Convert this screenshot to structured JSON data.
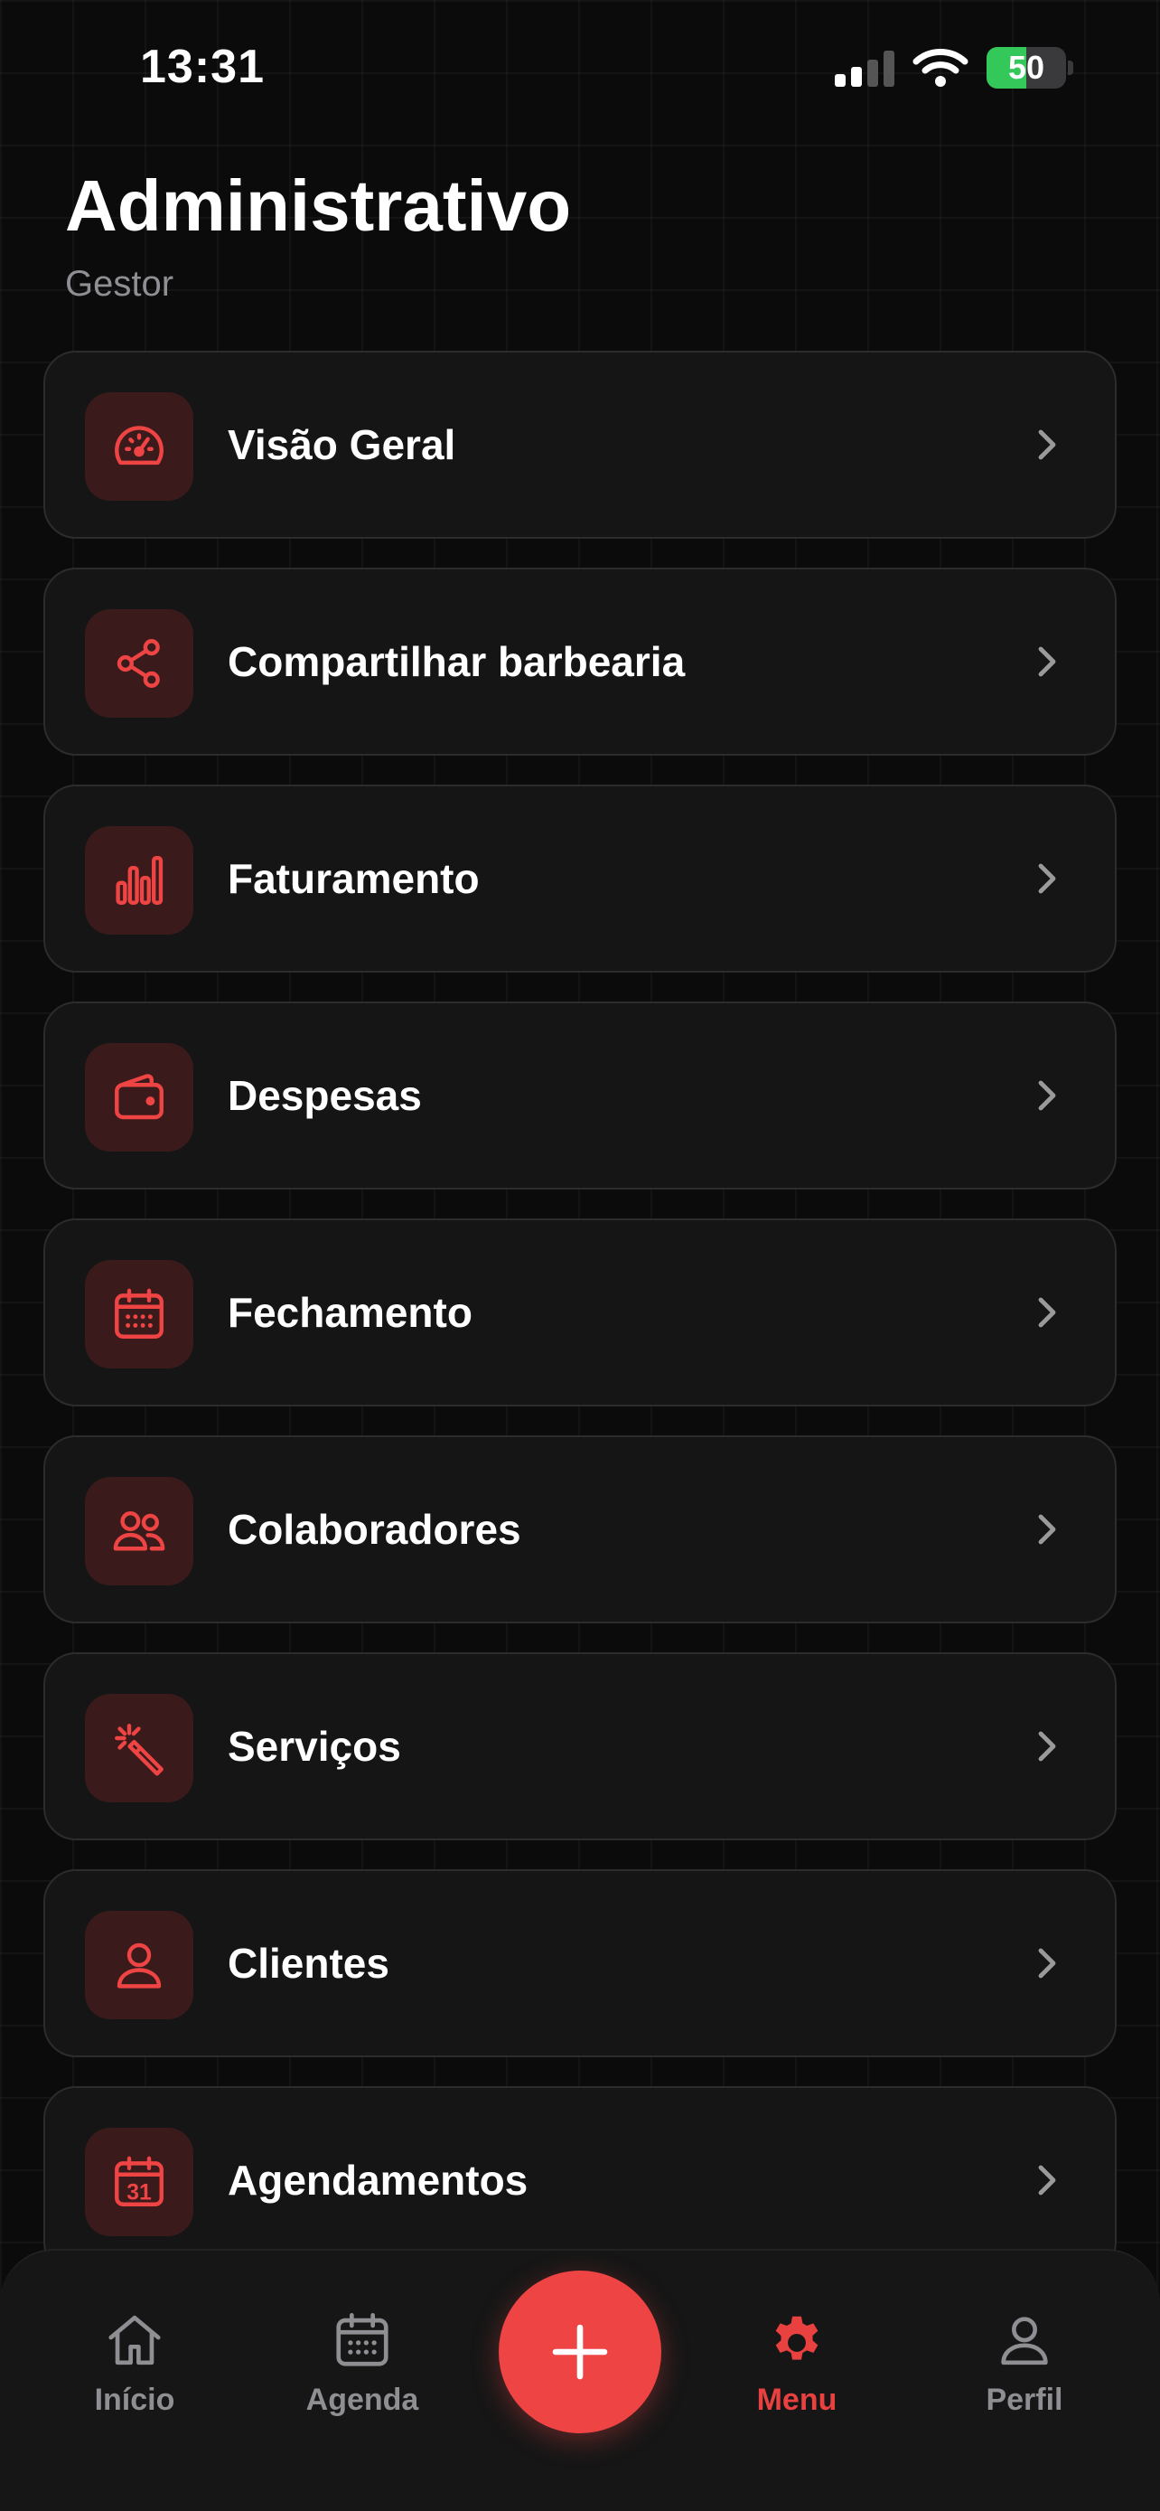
{
  "status_bar": {
    "time": "13:31",
    "battery": "50",
    "battery_level": 0.5
  },
  "header": {
    "title": "Administrativo",
    "subtitle": "Gestor"
  },
  "menu": {
    "items": [
      {
        "label": "Visão Geral",
        "icon": "speedometer-icon"
      },
      {
        "label": "Compartilhar barbearia",
        "icon": "share-icon"
      },
      {
        "label": "Faturamento",
        "icon": "bar-chart-icon"
      },
      {
        "label": "Despesas",
        "icon": "wallet-icon"
      },
      {
        "label": "Fechamento",
        "icon": "calendar-icon"
      },
      {
        "label": "Colaboradores",
        "icon": "users-icon"
      },
      {
        "label": "Serviços",
        "icon": "magic-wand-icon"
      },
      {
        "label": "Clientes",
        "icon": "user-icon"
      },
      {
        "label": "Agendamentos",
        "icon": "calendar-31-icon",
        "icon_text": "31"
      }
    ]
  },
  "tabbar": {
    "items": [
      {
        "label": "Início",
        "icon": "home-icon"
      },
      {
        "label": "Agenda",
        "icon": "calendar-icon"
      },
      {
        "label": "Menu",
        "icon": "gear-icon",
        "active": true
      },
      {
        "label": "Perfil",
        "icon": "user-icon"
      }
    ],
    "fab_icon": "plus-icon"
  },
  "colors": {
    "accent": "#ef4444",
    "icon_bg": "#3a1a1b",
    "card_bg": "#151515",
    "inactive": "#8e8e93",
    "battery": "#34c759"
  }
}
